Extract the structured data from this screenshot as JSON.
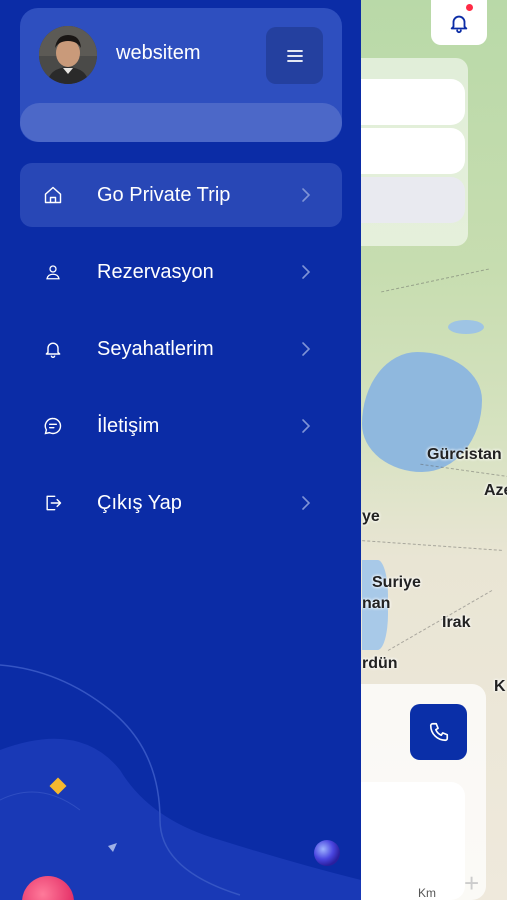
{
  "profile": {
    "username": "websitem",
    "menu_icon": "hamburger-icon"
  },
  "menu": {
    "items": [
      {
        "label": "Go Private Trip",
        "icon": "home-icon",
        "active": true
      },
      {
        "label": "Rezervasyon",
        "icon": "user-icon",
        "active": false
      },
      {
        "label": "Seyahatlerim",
        "icon": "bell-icon",
        "active": false
      },
      {
        "label": "İletişim",
        "icon": "chat-icon",
        "active": false
      },
      {
        "label": "Çıkış Yap",
        "icon": "logout-icon",
        "active": false
      }
    ]
  },
  "map": {
    "labels": {
      "gurcistan": "Gürcistan",
      "aze": "Aze",
      "ye": "ye",
      "suriye": "Suriye",
      "nan": "nan",
      "irak": "Irak",
      "urdun": "rdün",
      "k": "K"
    },
    "scale_unit": "Km",
    "zoom_in": "+"
  },
  "colors": {
    "drawer_bg": "#0b2ca6",
    "card_bg": "#2e4fbf",
    "active_item": "#2847b6",
    "call_button": "#0a2fa8",
    "notification_dot": "#ff2a45"
  }
}
